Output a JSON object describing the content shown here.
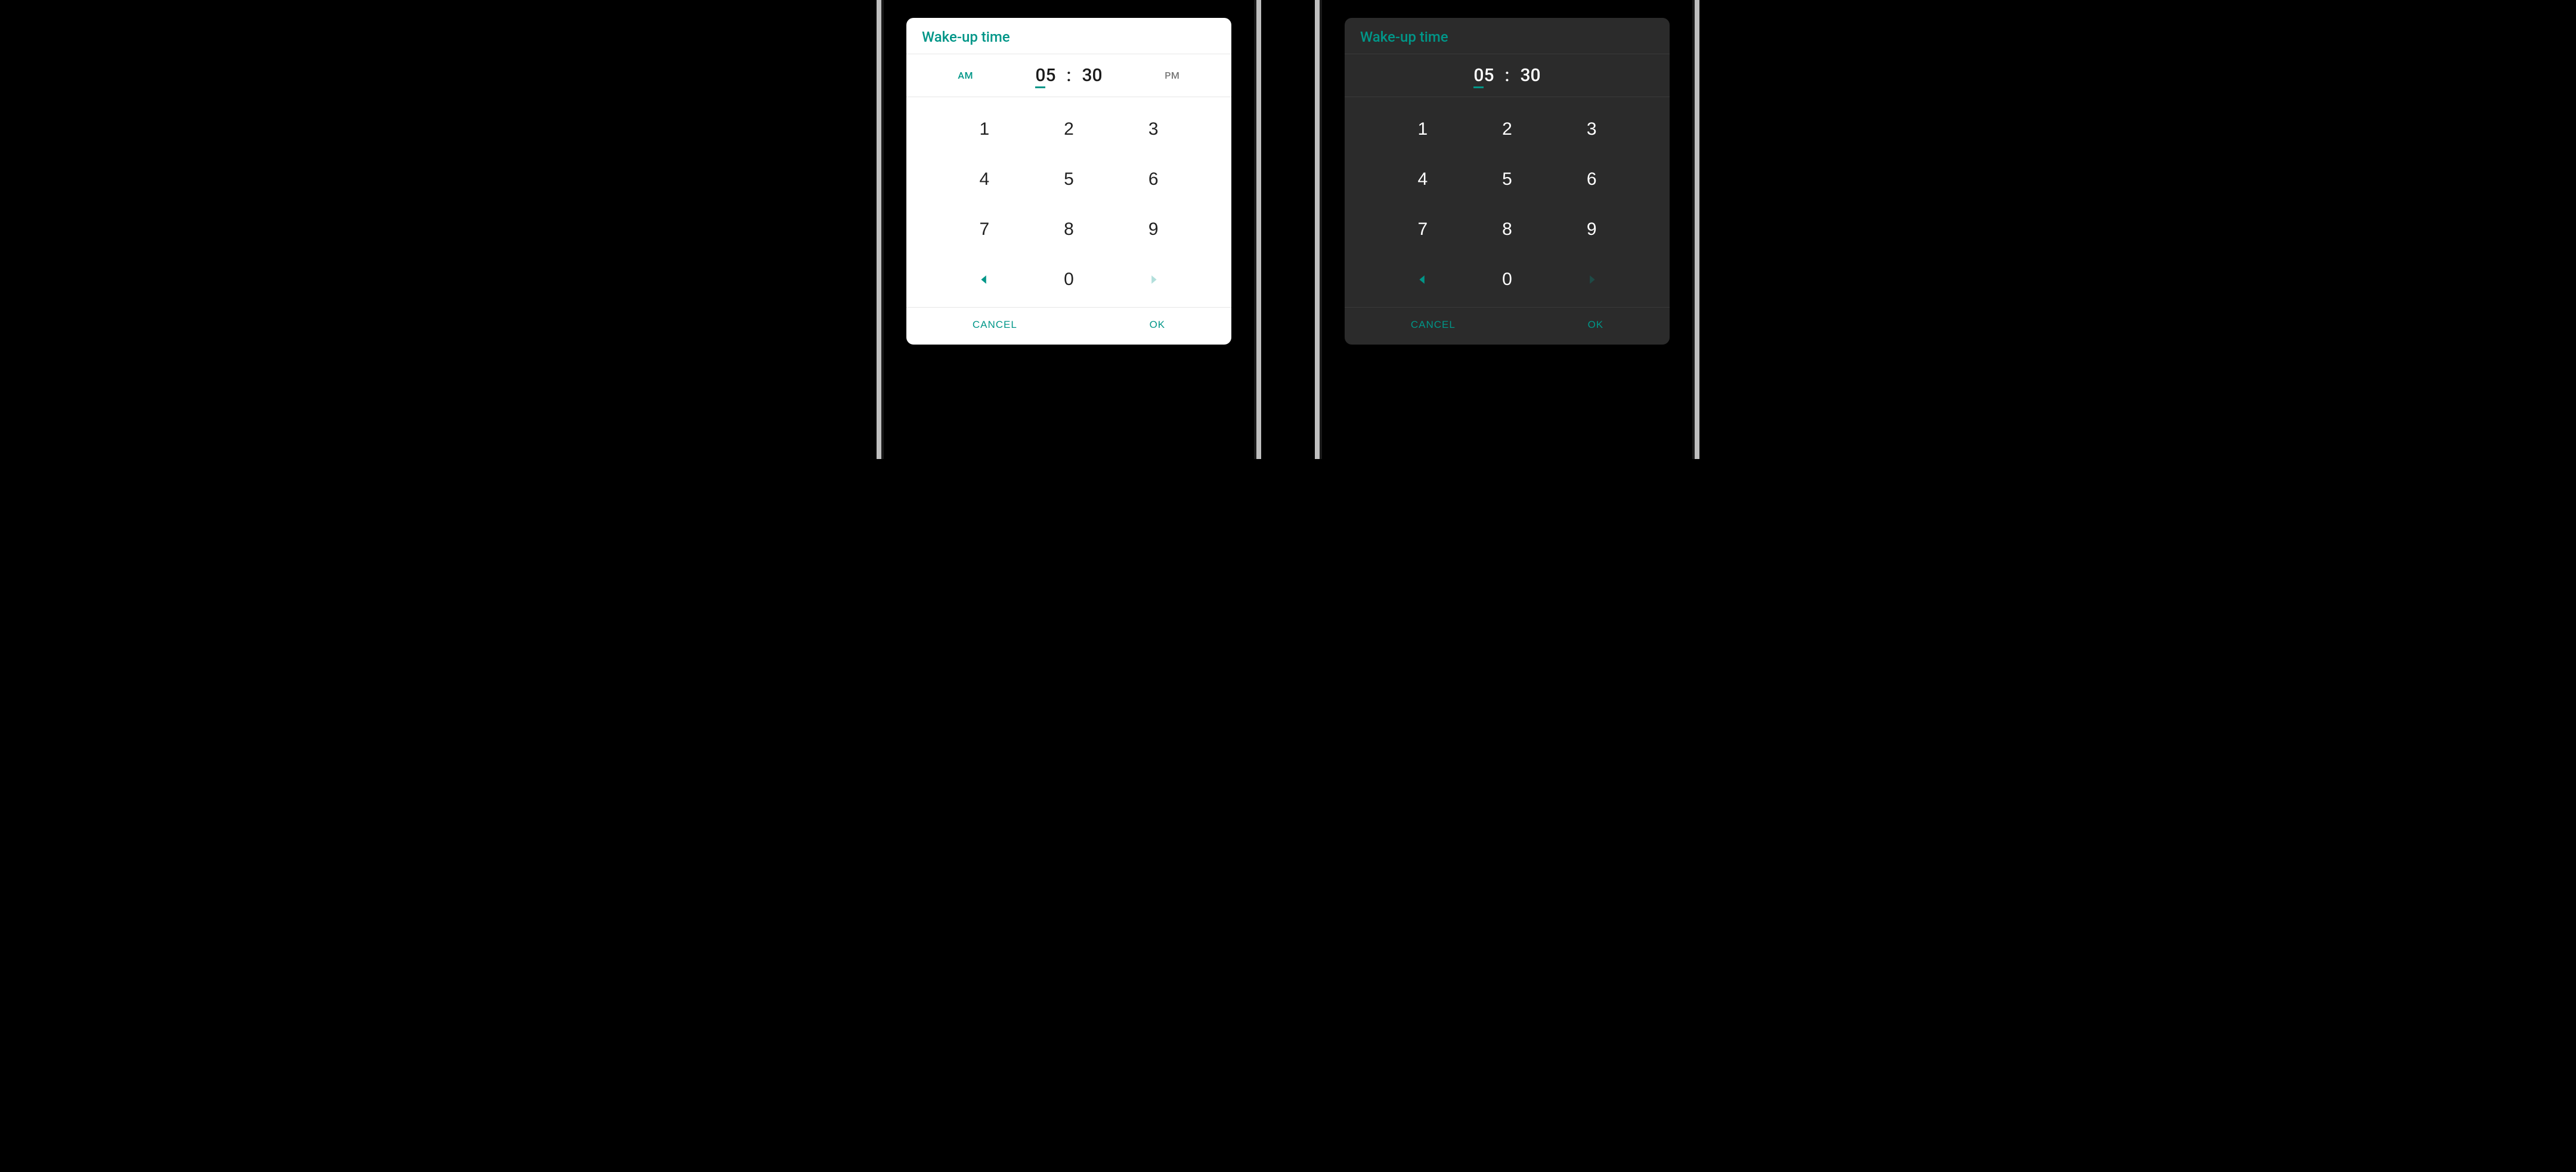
{
  "colors": {
    "accent": "#009688"
  },
  "dialog": {
    "title": "Wake-up time",
    "time": {
      "hour_first_digit": "0",
      "hour_second_digit": "5",
      "separator": ":",
      "minute": "30"
    },
    "ampm": {
      "am_label": "AM",
      "pm_label": "PM",
      "selected": "AM"
    },
    "keypad": {
      "keys": [
        "1",
        "2",
        "3",
        "4",
        "5",
        "6",
        "7",
        "8",
        "9",
        "0"
      ],
      "left_arrow": "triangle-left-icon",
      "right_arrow": "triangle-right-icon",
      "right_arrow_disabled": true
    },
    "footer": {
      "cancel": "CANCEL",
      "ok": "OK"
    }
  },
  "phones": [
    {
      "theme": "light",
      "show_ampm": true
    },
    {
      "theme": "dark",
      "show_ampm": false
    }
  ]
}
